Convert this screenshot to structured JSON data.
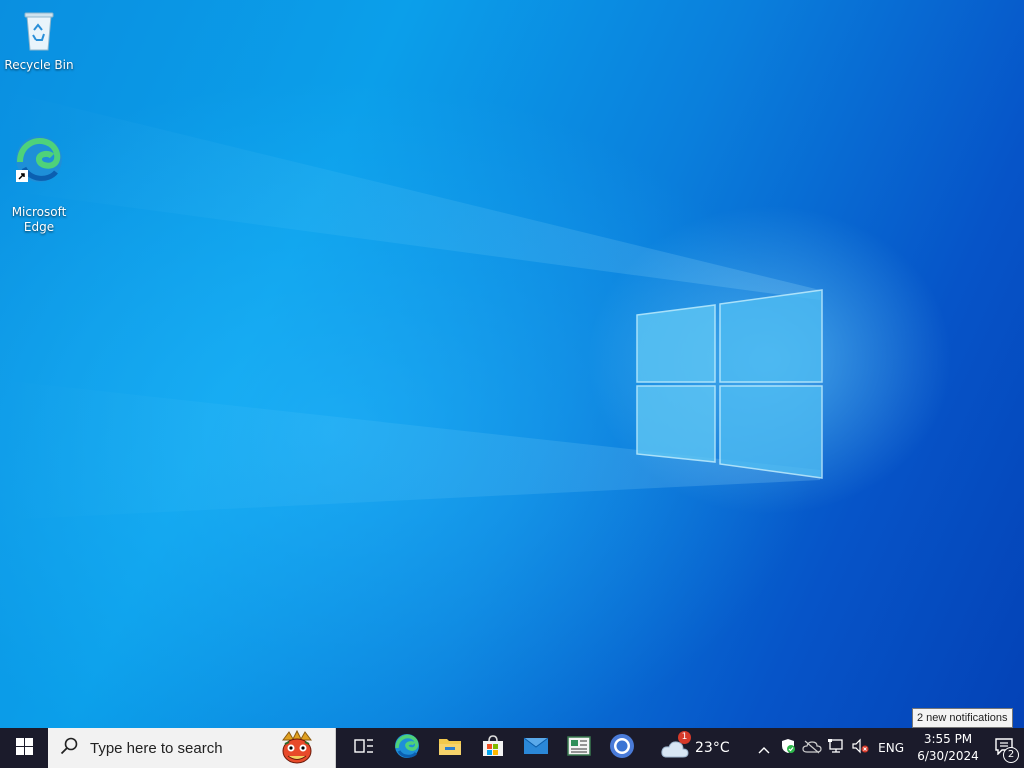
{
  "desktop": {
    "icons": [
      {
        "label": "Recycle Bin",
        "icon": "recycle-bin-icon"
      },
      {
        "label": "Microsoft\nEdge",
        "icon": "edge-icon"
      }
    ]
  },
  "taskbar": {
    "start_icon": "windows-logo-icon",
    "search": {
      "placeholder": "Type here to search",
      "icon": "search-icon"
    },
    "apps": [
      {
        "name": "Task View",
        "icon": "task-view-icon"
      },
      {
        "name": "Microsoft Edge",
        "icon": "edge-icon"
      },
      {
        "name": "File Explorer",
        "icon": "folder-icon"
      },
      {
        "name": "Microsoft Store",
        "icon": "store-icon"
      },
      {
        "name": "Mail",
        "icon": "mail-icon"
      },
      {
        "name": "Reader",
        "icon": "reader-icon"
      },
      {
        "name": "Chrome",
        "icon": "chrome-icon"
      }
    ],
    "weather": {
      "temp": "23°C",
      "badge": "1",
      "icon": "cloud-icon"
    },
    "tray": {
      "language": "ENG",
      "time": "3:55 PM",
      "date": "6/30/2024",
      "notifications_count": "2"
    }
  },
  "tooltip": {
    "text": "2 new notifications"
  },
  "colors": {
    "taskbar": "#1b1b2b",
    "accent": "#0a78d7",
    "search_bg": "#f2f2f2"
  }
}
